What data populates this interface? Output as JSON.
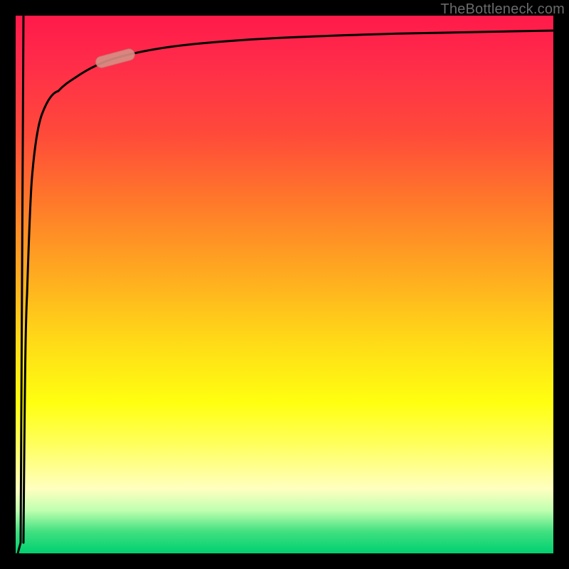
{
  "watermark": {
    "text": "TheBottleneck.com"
  },
  "colors": {
    "frame": "#000000",
    "curve": "#000000",
    "highlight_fill": "#d98f85",
    "highlight_stroke": "#c37a70",
    "watermark": "#6a6a6a"
  },
  "chart_data": {
    "type": "line",
    "title": "",
    "xlabel": "",
    "ylabel": "",
    "xlim": [
      0,
      100
    ],
    "ylim": [
      0,
      100
    ],
    "grid": false,
    "legend": false,
    "background": "vertical-gradient green-yellow-red (bottom-to-top)",
    "series": [
      {
        "name": "spike",
        "x": [
          0.4,
          0.9,
          1.4
        ],
        "y": [
          100,
          2,
          100
        ]
      },
      {
        "name": "main-curve",
        "x": [
          1.4,
          2,
          3,
          4,
          5,
          7,
          10,
          15,
          20,
          30,
          40,
          50,
          60,
          70,
          80,
          90,
          100
        ],
        "y": [
          2,
          48,
          70,
          78,
          82,
          86,
          89,
          91.5,
          93,
          94.2,
          95,
          95.6,
          96.1,
          96.5,
          96.8,
          97,
          97.2
        ]
      }
    ],
    "annotations": [
      {
        "name": "highlight-pill",
        "x_range": [
          15,
          22
        ],
        "y_range": [
          91,
          93.5
        ],
        "shape": "rounded-pill"
      }
    ]
  }
}
